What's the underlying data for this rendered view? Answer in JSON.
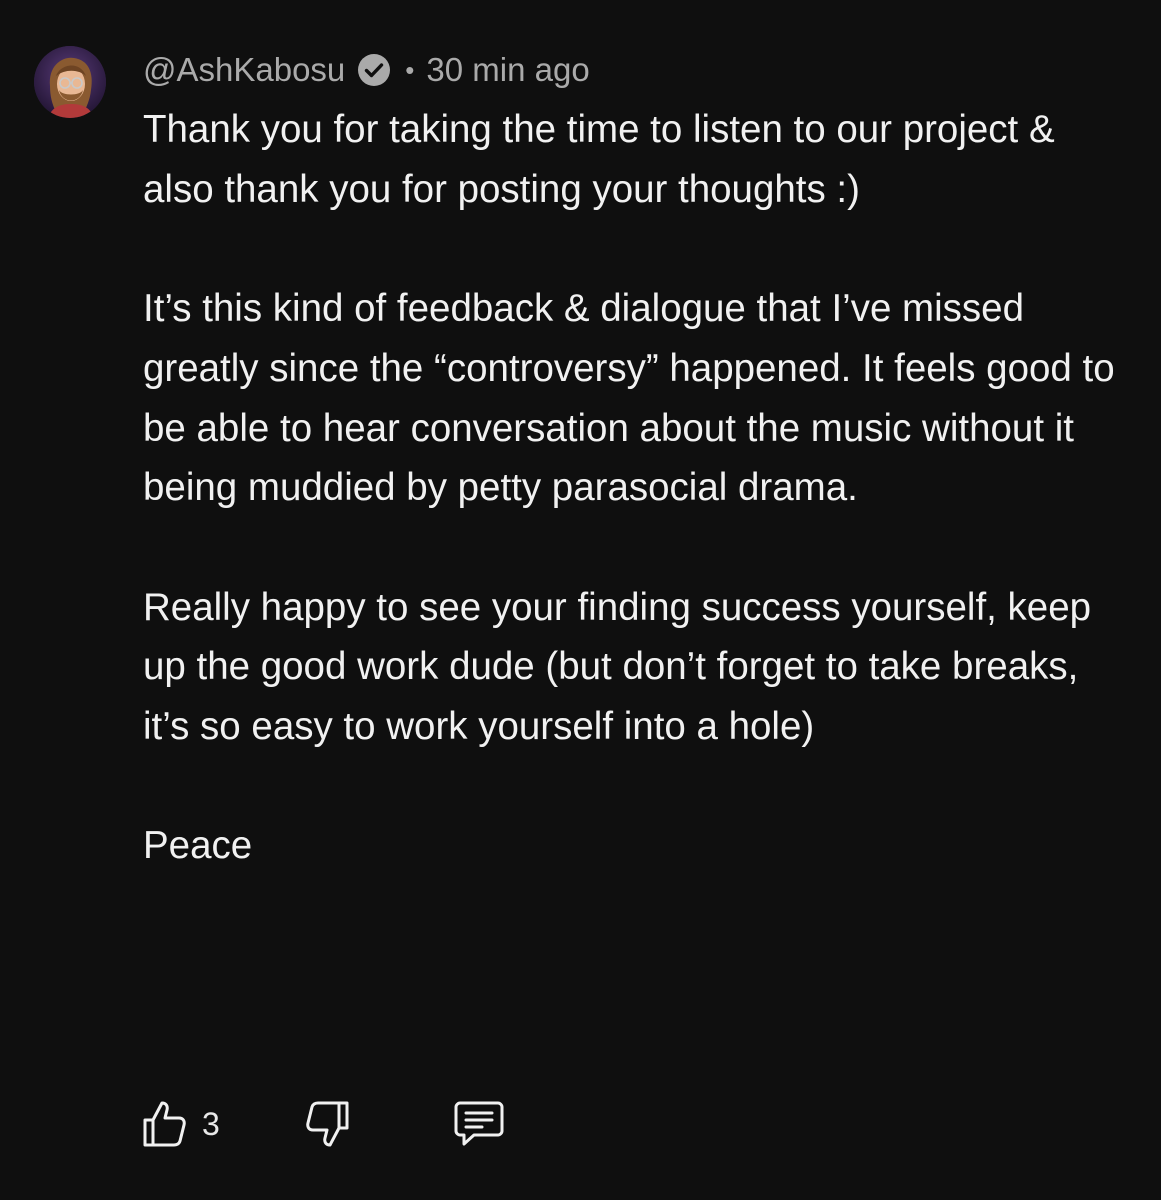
{
  "comment": {
    "author": "@AshKabosu",
    "verified": true,
    "separator": "•",
    "timestamp": "30 min ago",
    "avatar_icon": "avatar-icon",
    "paragraphs": [
      "Thank you for taking the time to listen to our project & also thank you for posting your thoughts :)",
      "It’s this kind of feedback & dialogue that I’ve missed greatly since the “controversy” happened. It feels good to be able to hear conversation about the music without it being muddied by petty parasocial drama.",
      "Really happy to see your finding success yourself, keep up the good work dude (but don’t forget to take breaks, it’s so easy to work yourself into a hole)",
      "Peace"
    ],
    "actions": {
      "like_icon": "thumbs-up-icon",
      "like_count": "3",
      "dislike_icon": "thumbs-down-icon",
      "reply_icon": "reply-comment-icon"
    }
  },
  "colors": {
    "background": "#0f0f0f",
    "text_primary": "#f1f1f1",
    "text_secondary": "#aaaaaa"
  }
}
